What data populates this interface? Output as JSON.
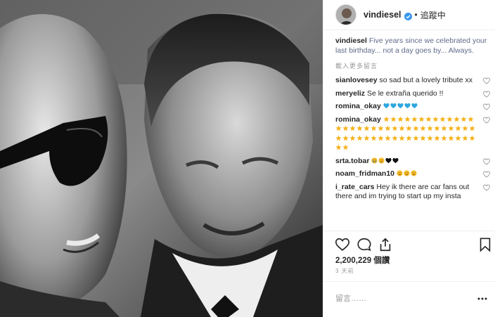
{
  "post": {
    "username": "vindiesel",
    "follow_status": "追蹤中",
    "separator": "•",
    "caption": "Five years since we celebrated your last birthday... not a day goes by... Always.",
    "load_more": "載入更多留言",
    "likes": "2,200,229 個讚",
    "time_ago": "3 天前",
    "comment_placeholder": "留言……"
  },
  "comments": [
    {
      "user": "sianlovesey",
      "text": "so sad but a lovely tribute xx"
    },
    {
      "user": "meryeliz",
      "text": "Se le extraña querido !!"
    },
    {
      "user": "romina_okay",
      "text": "",
      "icons": [
        "blue-heart",
        "blue-heart",
        "blue-heart",
        "blue-heart",
        "blue-heart"
      ]
    },
    {
      "user": "romina_okay",
      "text": "",
      "star_count": 55
    },
    {
      "user": "srta.tobar",
      "text": "",
      "icons": [
        "crying-face",
        "disappointed-face",
        "black-heart",
        "black-heart"
      ]
    },
    {
      "user": "noam_fridman10",
      "text": "",
      "icons": [
        "disappointed-face",
        "disappointed-face",
        "disappointed-face"
      ]
    },
    {
      "user": "i_rate_cars",
      "text": "Hey ik there are car fans out there and im trying to start up my insta"
    }
  ],
  "colors": {
    "verified_badge": "#3897f0",
    "blue_heart": "#2fa7e0",
    "star": "#f5b21a",
    "face": "#f6bd2a"
  }
}
